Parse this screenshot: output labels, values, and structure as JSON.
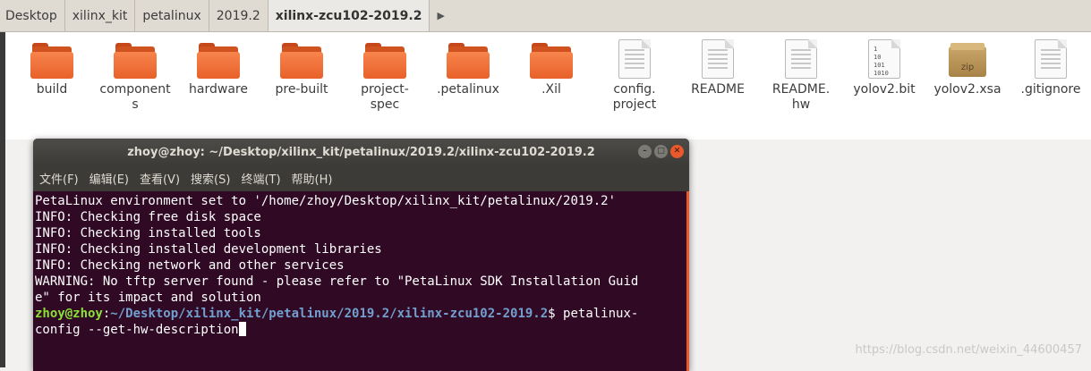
{
  "pathbar": {
    "crumbs": [
      "Desktop",
      "xilinx_kit",
      "petalinux",
      "2019.2",
      "xilinx-zcu102-2019.2"
    ],
    "more_arrow": "▶"
  },
  "files": [
    {
      "name": "build",
      "icon": "folder-icon"
    },
    {
      "name": "component\ns",
      "icon": "folder-icon"
    },
    {
      "name": "hardware",
      "icon": "folder-icon"
    },
    {
      "name": "pre-built",
      "icon": "folder-icon"
    },
    {
      "name": "project-\nspec",
      "icon": "folder-icon"
    },
    {
      "name": ".petalinux",
      "icon": "folder-icon"
    },
    {
      "name": ".Xil",
      "icon": "folder-icon"
    },
    {
      "name": "config.\nproject",
      "icon": "text-file-icon"
    },
    {
      "name": "README",
      "icon": "text-file-icon"
    },
    {
      "name": "README.\nhw",
      "icon": "text-file-icon"
    },
    {
      "name": "yolov2.bit",
      "icon": "binary-file-icon",
      "binary_text": "1\n10\n101\n1010"
    },
    {
      "name": "yolov2.xsa",
      "icon": "zip-archive-icon",
      "badge": "zip"
    },
    {
      "name": ".gitignore",
      "icon": "text-file-icon"
    }
  ],
  "terminal": {
    "title": "zhoy@zhoy: ~/Desktop/xilinx_kit/petalinux/2019.2/xilinx-zcu102-2019.2",
    "menu": [
      "文件(F)",
      "编辑(E)",
      "查看(V)",
      "搜索(S)",
      "终端(T)",
      "帮助(H)"
    ],
    "lines": [
      "PetaLinux environment set to '/home/zhoy/Desktop/xilinx_kit/petalinux/2019.2'",
      "INFO: Checking free disk space",
      "INFO: Checking installed tools",
      "INFO: Checking installed development libraries",
      "INFO: Checking network and other services",
      "WARNING: No tftp server found - please refer to \"PetaLinux SDK Installation Guid",
      "e\" for its impact and solution"
    ],
    "prompt_user": "zhoy@zhoy",
    "prompt_colon": ":",
    "prompt_path": "~/Desktop/xilinx_kit/petalinux/2019.2/xilinx-zcu102-2019.2",
    "prompt_tail": "$ petalinux-",
    "command_cont": "config --get-hw-description"
  },
  "watermark": "https://blog.csdn.net/weixin_44600457",
  "colors": {
    "terminal_bg": "#300a24",
    "prompt_user": "#8ae234",
    "prompt_path": "#729fcf",
    "folder": "#e8612a"
  }
}
